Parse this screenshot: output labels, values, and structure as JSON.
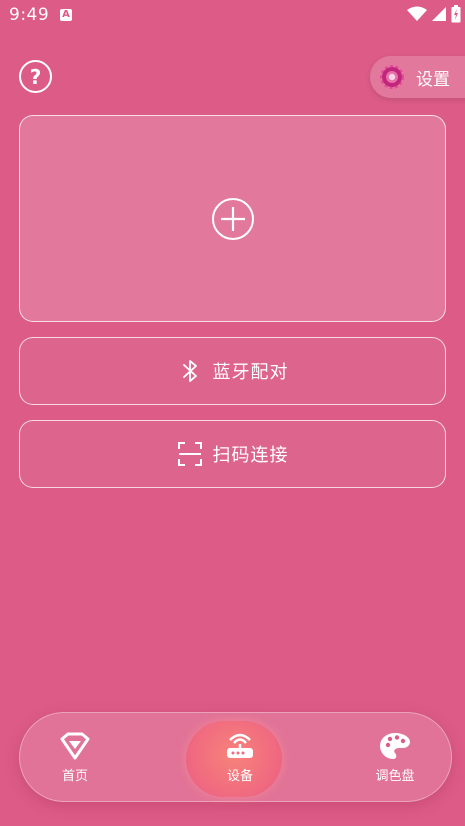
{
  "status": {
    "time": "9:49",
    "notification_glyph": "A"
  },
  "header": {
    "help_label": "?",
    "settings_label": "设置"
  },
  "cards": {
    "pair_label": "蓝牙配对",
    "scan_label": "扫码连接"
  },
  "nav": [
    {
      "label": "首页",
      "icon": "home-logo-icon"
    },
    {
      "label": "设备",
      "icon": "router-icon",
      "active": true
    },
    {
      "label": "调色盘",
      "icon": "palette-icon"
    }
  ],
  "colors": {
    "background": "#dc5c87",
    "active_nav": "#f06a80",
    "settings_gear": "#c2267c"
  }
}
